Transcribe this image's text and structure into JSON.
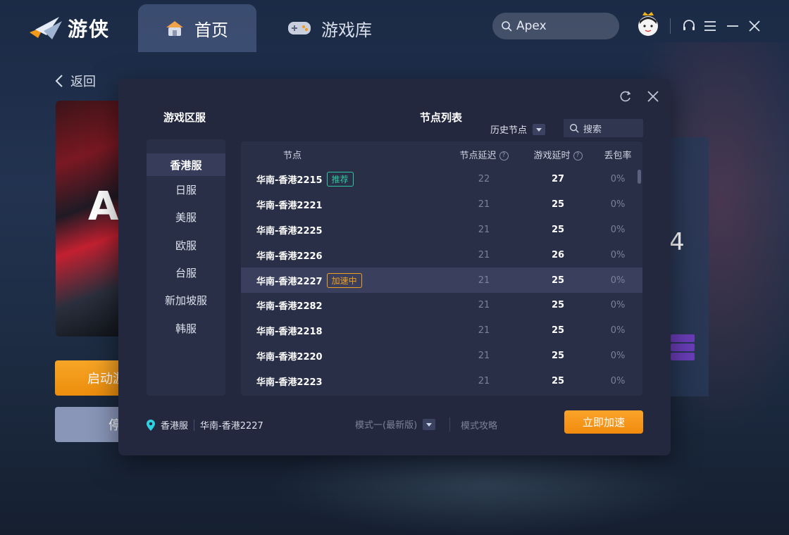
{
  "app": {
    "name": "游侠"
  },
  "tabs": [
    {
      "label": "首页"
    },
    {
      "label": "游戏库"
    }
  ],
  "search": {
    "value": "Apex"
  },
  "page": {
    "back_label": "返回",
    "cover_text": "A",
    "start_label": "启动游",
    "stop_label": "停",
    "side_value": "4"
  },
  "modal": {
    "zone_title": "游戏区服",
    "zones": [
      "香港服",
      "日服",
      "美服",
      "欧服",
      "台服",
      "新加坡服",
      "韩服"
    ],
    "node_title": "节点列表",
    "history_label": "历史节点",
    "search_placeholder": "搜索",
    "columns": {
      "node": "节点",
      "node_latency": "节点延迟",
      "game_latency": "游戏延时",
      "loss": "丢包率"
    },
    "rows": [
      {
        "name": "华南-香港2215",
        "tag": "推荐",
        "node_latency": "22",
        "game_latency": "27",
        "loss": "0%"
      },
      {
        "name": "华南-香港2221",
        "tag": "",
        "node_latency": "21",
        "game_latency": "25",
        "loss": "0%"
      },
      {
        "name": "华南-香港2225",
        "tag": "",
        "node_latency": "21",
        "game_latency": "25",
        "loss": "0%"
      },
      {
        "name": "华南-香港2226",
        "tag": "",
        "node_latency": "21",
        "game_latency": "26",
        "loss": "0%"
      },
      {
        "name": "华南-香港2227",
        "tag": "加速中",
        "node_latency": "21",
        "game_latency": "25",
        "loss": "0%"
      },
      {
        "name": "华南-香港2282",
        "tag": "",
        "node_latency": "21",
        "game_latency": "25",
        "loss": "0%"
      },
      {
        "name": "华南-香港2218",
        "tag": "",
        "node_latency": "21",
        "game_latency": "25",
        "loss": "0%"
      },
      {
        "name": "华南-香港2220",
        "tag": "",
        "node_latency": "21",
        "game_latency": "25",
        "loss": "0%"
      },
      {
        "name": "华南-香港2223",
        "tag": "",
        "node_latency": "21",
        "game_latency": "25",
        "loss": "0%"
      }
    ],
    "footer": {
      "zone": "香港服",
      "node": "华南-香港2227",
      "mode": "模式一(最新版)",
      "guide": "模式攻略",
      "accelerate_label": "立即加速"
    }
  },
  "colors": {
    "accent": "#f39a1a",
    "recommend": "#2fc8a0",
    "accelerating": "#f0a020",
    "modal_bg": "#24283e"
  },
  "icons": [
    "logo-icon",
    "home-icon",
    "gamepad-icon",
    "search-icon",
    "avatar-icon",
    "headset-icon",
    "menu-icon",
    "minimize-icon",
    "close-icon",
    "back-icon",
    "refresh-icon",
    "location-pin-icon"
  ]
}
